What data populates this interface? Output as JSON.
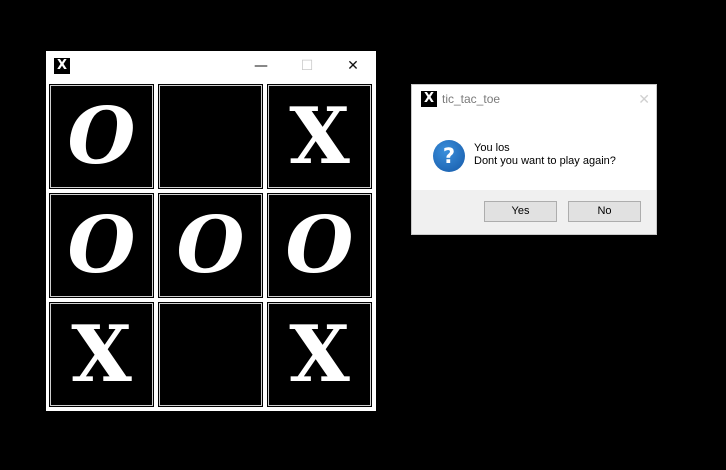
{
  "game_window": {
    "icon": "X",
    "controls": {
      "minimize": "—",
      "maximize": "☐",
      "close": "✕"
    },
    "board": [
      "O",
      "",
      "X",
      "O",
      "O",
      "O",
      "X",
      "",
      "X"
    ]
  },
  "dialog": {
    "icon": "X",
    "title": "tic_tac_toe",
    "close": "✕",
    "question_icon": "?",
    "message_line1": "You los",
    "message_line2": "Dont you want to play again?",
    "yes_label": "Yes",
    "no_label": "No"
  }
}
